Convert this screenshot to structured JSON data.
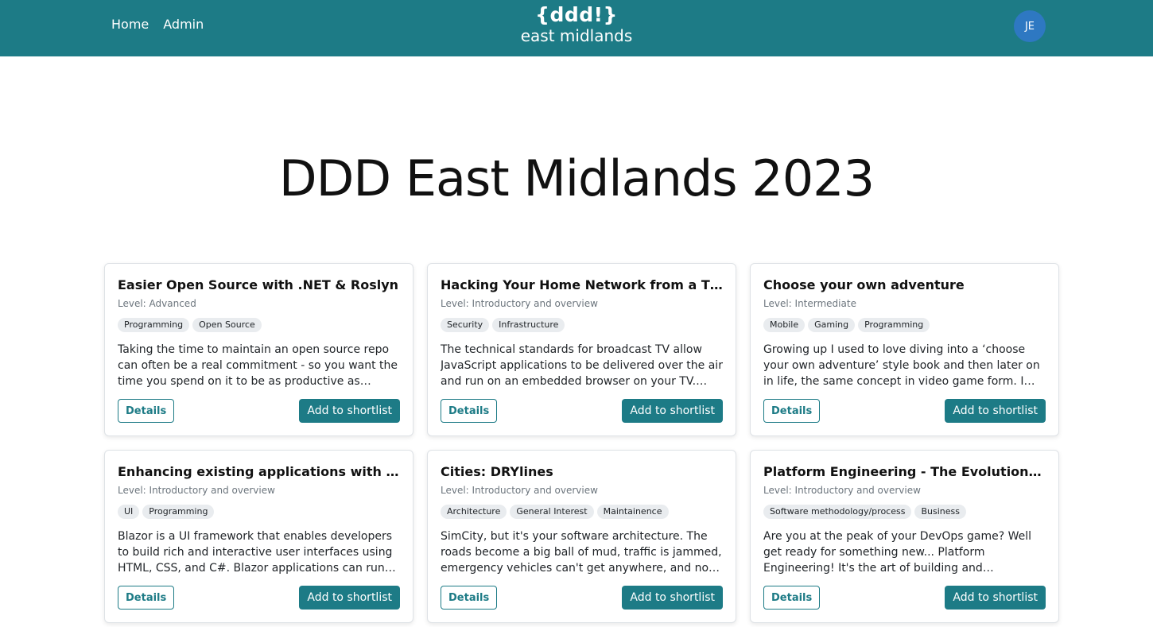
{
  "header": {
    "nav": [
      "Home",
      "Admin"
    ],
    "logo_main": "{ddd!}",
    "logo_sub": "east midlands",
    "avatar_initials": "JE"
  },
  "page": {
    "title": "DDD East Midlands 2023"
  },
  "buttons": {
    "details": "Details",
    "shortlist": "Add to shortlist"
  },
  "sessions": [
    {
      "title": "Easier Open Source with .NET & Roslyn",
      "level": "Level: Advanced",
      "tags": [
        "Programming",
        "Open Source"
      ],
      "description": "Taking the time to maintain an open source repo can often be a real commitment - so you want the time you spend on it to be as productive as possible. In this..."
    },
    {
      "title": "Hacking Your Home Network from a TV...",
      "level": "Level: Introductory and overview",
      "tags": [
        "Security",
        "Infrastructure"
      ],
      "description": "The technical standards for broadcast TV allow JavaScript applications to be delivered over the air and run on an embedded browser on your TV. Given..."
    },
    {
      "title": "Choose your own adventure",
      "level": "Level: Intermediate",
      "tags": [
        "Mobile",
        "Gaming",
        "Programming"
      ],
      "description": "Growing up I used to love diving into a ‘choose your own adventure’ style book and then later on in life, the same concept in video game form. I would like to..."
    },
    {
      "title": "Enhancing existing applications with Blazor: ...",
      "level": "Level: Introductory and overview",
      "tags": [
        "UI",
        "Programming"
      ],
      "description": "Blazor is a UI framework that enables developers to build rich and interactive user interfaces using HTML, CSS, and C#. Blazor applications can run on desktop,..."
    },
    {
      "title": "Cities: DRYlines",
      "level": "Level: Introductory and overview",
      "tags": [
        "Architecture",
        "General Interest",
        "Maintainence"
      ],
      "description": "SimCity, but it's your software architecture. The roads become a big ball of mud, traffic is jammed, emergency vehicles can't get anywhere, and now the..."
    },
    {
      "title": "Platform Engineering - The Evolution of...",
      "level": "Level: Introductory and overview",
      "tags": [
        "Software methodology/process",
        "Business"
      ],
      "description": "Are you at the peak of your DevOps game? Well get ready for something new... Platform Engineering! It's the art of building and maintaining a scalable, efficien..."
    }
  ]
}
